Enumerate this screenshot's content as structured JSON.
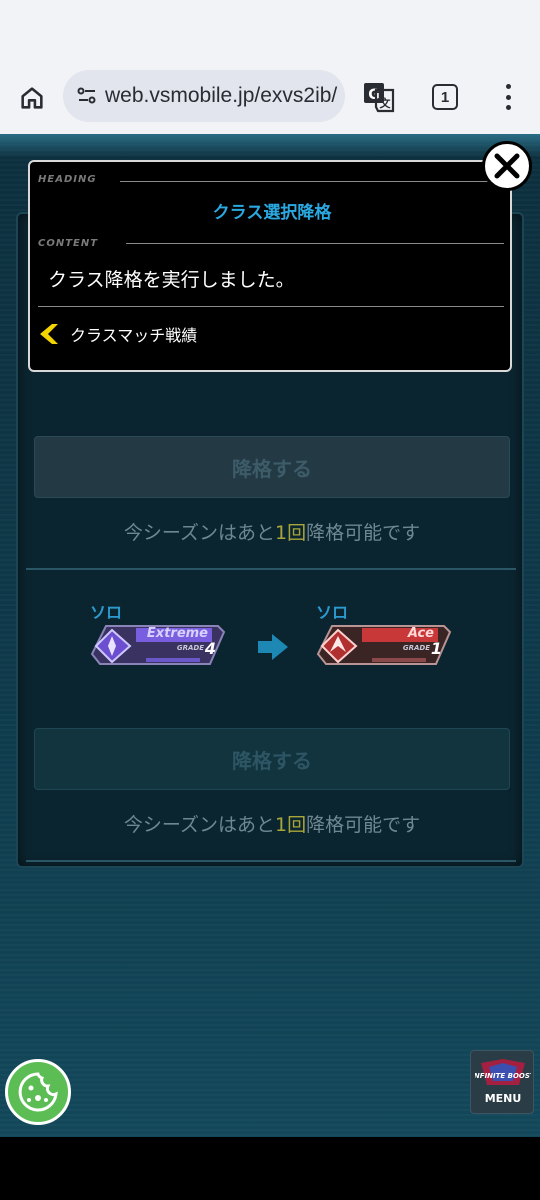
{
  "browser": {
    "url": "web.vsmobile.jp/exvs2ib/",
    "tab_count": "1"
  },
  "page": {
    "button_label": "降格する",
    "remain_prefix": "今シーズンはあと",
    "remain_count": "1",
    "remain_unit": "回",
    "remain_suffix": "降格可能です",
    "solo_label": "ソロ",
    "from_badge": {
      "title": "Extreme",
      "grade_label": "GRADE",
      "grade": "4"
    },
    "to_badge": {
      "title": "Ace",
      "grade_label": "GRADE",
      "grade": "1"
    },
    "menu_label": "MENU",
    "menu_logo_text": "INFINITE BOOST"
  },
  "modal": {
    "heading_label": "HEADING",
    "heading": "クラス選択降格",
    "content_label": "CONTENT",
    "content": "クラス降格を実行しました。",
    "link": "クラスマッチ戦績"
  },
  "colors": {
    "accent_blue": "#2aa8e0",
    "cookie_green": "#5cbd55",
    "highlight_num": "#a8a63a"
  },
  "icons": [
    "home-icon",
    "tune-icon",
    "translate-icon",
    "more-vert-icon",
    "close-icon",
    "chevron-left-icon",
    "arrow-right-icon",
    "cookie-icon"
  ]
}
